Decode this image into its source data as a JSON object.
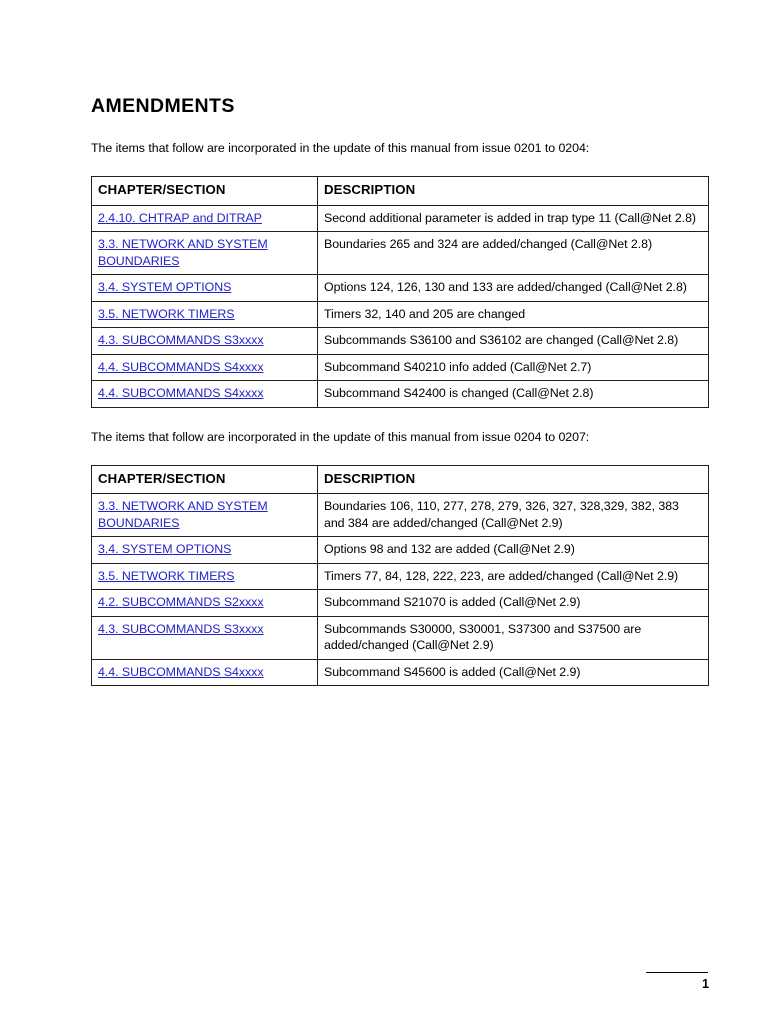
{
  "document": {
    "title": "AMENDMENTS",
    "intro_1": "The items that follow are incorporated in the update of this manual from issue 0201 to 0204:",
    "intro_2": "The items that follow are incorporated in the update of this manual from issue 0204 to 0207:",
    "page_number": "1"
  },
  "table_1": {
    "headers": {
      "section": "CHAPTER/SECTION",
      "description": "DESCRIPTION"
    },
    "rows": [
      {
        "section": "2.4.10. CHTRAP and DITRAP",
        "description": "Second additional parameter is added in trap type 11 (Call@Net 2.8)"
      },
      {
        "section": "3.3. NETWORK AND SYSTEM BOUNDARIES",
        "description": "Boundaries 265 and 324 are added/changed (Call@Net 2.8)"
      },
      {
        "section": "3.4. SYSTEM OPTIONS",
        "description": "Options 124, 126, 130 and 133 are added/changed (Call@Net 2.8)"
      },
      {
        "section": "3.5. NETWORK TIMERS",
        "description": "Timers 32, 140 and 205 are changed"
      },
      {
        "section": "4.3. SUBCOMMANDS S3xxxx",
        "description": "Subcommands S36100 and S36102 are changed (Call@Net 2.8)"
      },
      {
        "section": "4.4. SUBCOMMANDS S4xxxx",
        "description": "Subcommand S40210 info added (Call@Net 2.7)"
      },
      {
        "section": "4.4. SUBCOMMANDS S4xxxx",
        "description": "Subcommand S42400 is changed (Call@Net 2.8)"
      }
    ]
  },
  "table_2": {
    "headers": {
      "section": "CHAPTER/SECTION",
      "description": "DESCRIPTION"
    },
    "rows": [
      {
        "section": "3.3. NETWORK AND SYSTEM BOUNDARIES",
        "description": "Boundaries 106, 110, 277, 278, 279, 326, 327, 328,329, 382, 383 and 384 are added/changed (Call@Net 2.9)"
      },
      {
        "section": "3.4. SYSTEM OPTIONS",
        "description": "Options 98 and 132 are added (Call@Net 2.9)"
      },
      {
        "section": "3.5. NETWORK TIMERS",
        "description": "Timers 77, 84, 128, 222, 223, are added/changed (Call@Net 2.9)"
      },
      {
        "section": "4.2. SUBCOMMANDS S2xxxx",
        "description": "Subcommand S21070 is added (Call@Net 2.9)"
      },
      {
        "section": "4.3. SUBCOMMANDS S3xxxx",
        "description": "Subcommands S30000, S30001, S37300 and S37500 are added/changed (Call@Net 2.9)"
      },
      {
        "section": "4.4. SUBCOMMANDS S4xxxx",
        "description": "Subcommand S45600 is added (Call@Net 2.9)"
      }
    ]
  },
  "colors": {
    "link": "#2222cc",
    "text": "#000000",
    "border": "#231f20"
  }
}
